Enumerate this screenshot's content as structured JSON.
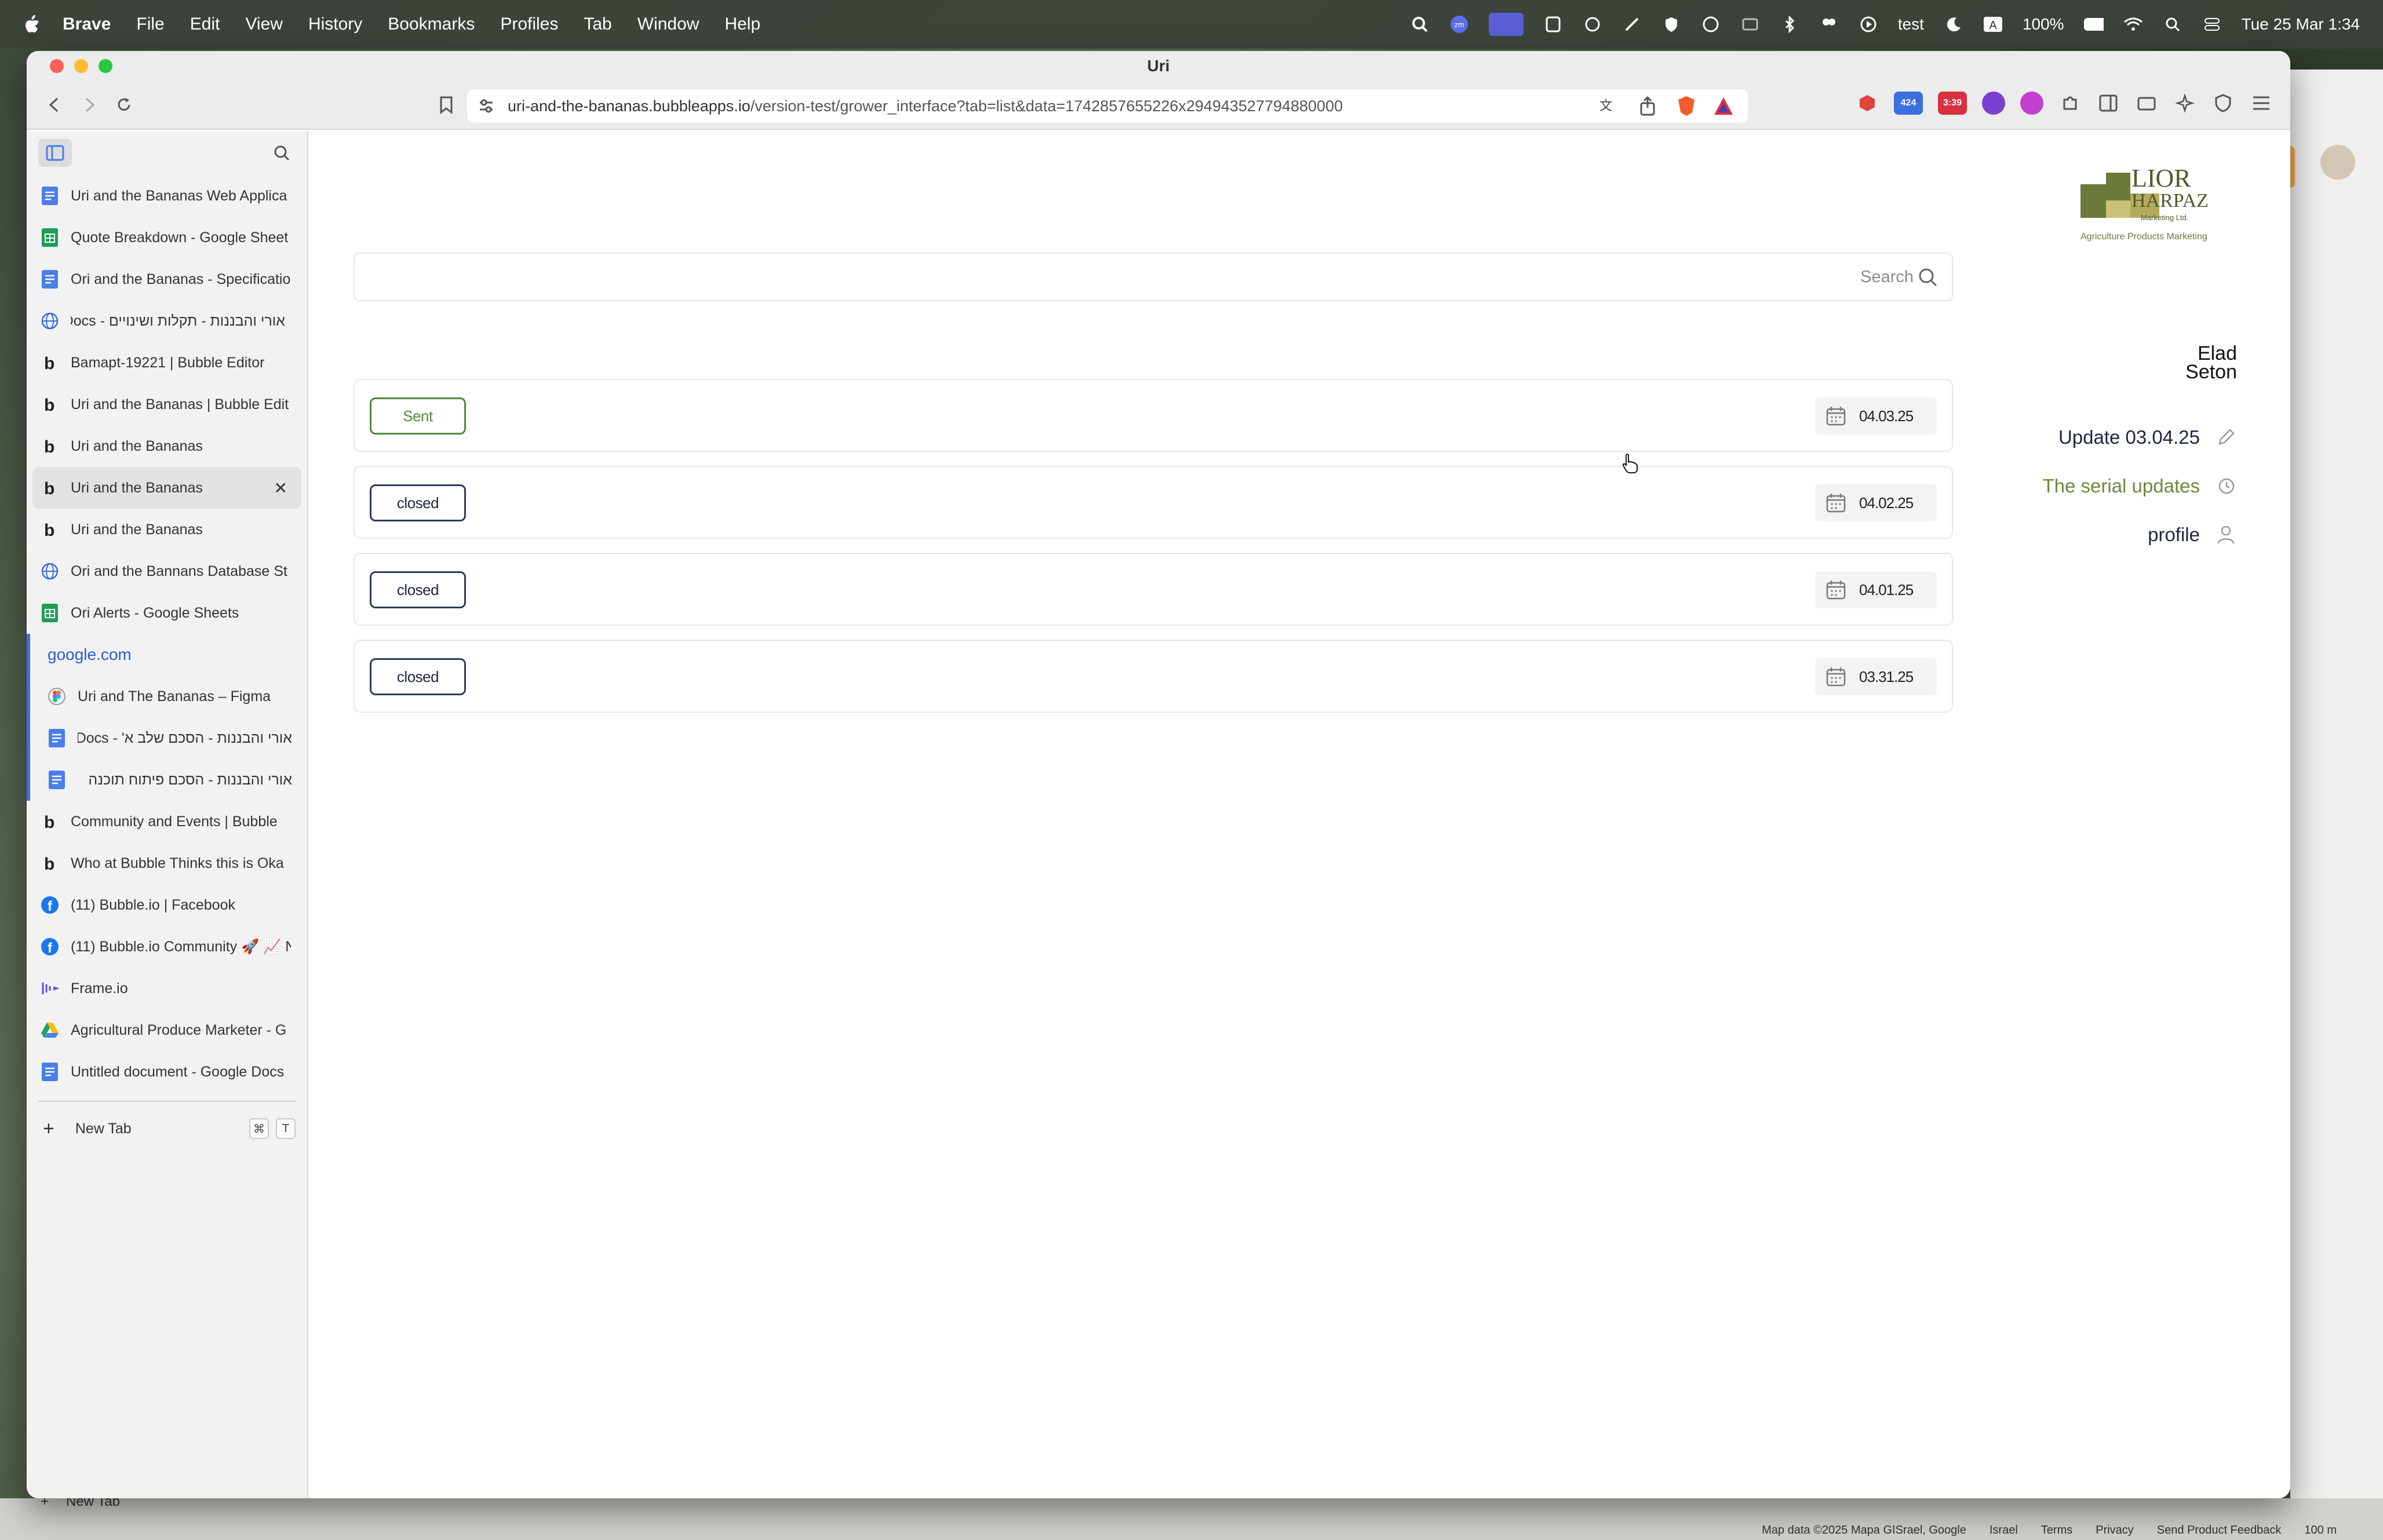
{
  "menubar": {
    "app": "Brave",
    "items": [
      "File",
      "Edit",
      "View",
      "History",
      "Bookmarks",
      "Profiles",
      "Tab",
      "Window",
      "Help"
    ],
    "tray": {
      "badge_text": "test",
      "battery": "100%",
      "datetime": "Tue 25 Mar  1:34"
    }
  },
  "window": {
    "title": "Uri",
    "url_host": "uri-and-the-bananas.bubbleapps.io",
    "url_path": "/version-test/grower_interface?tab=list&data=1742857655226x294943527794880000",
    "ext_badges": {
      "a": "424",
      "b": "3:39"
    }
  },
  "sidebar": {
    "tabs": [
      {
        "label": "Uri and the Bananas Web Applica",
        "icon": "google-docs-icon"
      },
      {
        "label": "Quote Breakdown - Google Sheet",
        "icon": "google-sheets-icon"
      },
      {
        "label": "Ori and the Bananas - Specificatio",
        "icon": "google-docs-icon"
      },
      {
        "label": "אורי והבננות - תקלות ושינויים - Docs",
        "icon": "globe-icon"
      },
      {
        "label": "Bamapt-19221 | Bubble Editor",
        "icon": "bubble-icon"
      },
      {
        "label": "Uri and the Bananas | Bubble Edit",
        "icon": "bubble-icon"
      },
      {
        "label": "Uri and the Bananas",
        "icon": "bubble-icon"
      },
      {
        "label": "Uri and the Bananas",
        "icon": "bubble-icon",
        "active": true
      },
      {
        "label": "Uri and the Bananas",
        "icon": "bubble-icon"
      },
      {
        "label": "Ori and the Bannans Database St",
        "icon": "globe-icon"
      },
      {
        "label": "Ori Alerts - Google Sheets",
        "icon": "google-sheets-icon"
      }
    ],
    "group_label": "google.com",
    "group_tabs": [
      {
        "label": "Uri and The Bananas – Figma",
        "icon": "figma-icon"
      },
      {
        "label": "אורי והבננות - הסכם שלב א' - Docs",
        "icon": "google-docs-icon"
      },
      {
        "label": "אורי והבננות - הסכם פיתוח תוכנה",
        "icon": "google-docs-icon"
      }
    ],
    "more_tabs": [
      {
        "label": "Community and Events | Bubble",
        "icon": "bubble-icon"
      },
      {
        "label": "Who at Bubble Thinks this is Oka",
        "icon": "bubble-icon"
      },
      {
        "label": "(11) Bubble.io | Facebook",
        "icon": "facebook-icon"
      },
      {
        "label": "(11) Bubble.io Community 🚀 📈 N",
        "icon": "facebook-icon"
      },
      {
        "label": "Frame.io",
        "icon": "frame-io-icon"
      },
      {
        "label": "Agricultural Produce Marketer - G",
        "icon": "google-drive-icon"
      },
      {
        "label": "Untitled document - Google Docs",
        "icon": "google-docs-icon"
      }
    ],
    "new_tab": {
      "label": "New Tab",
      "k1": "⌘",
      "k2": "T"
    }
  },
  "main": {
    "search_placeholder": "Search",
    "rows": [
      {
        "status": "Sent",
        "date": "04.03.25"
      },
      {
        "status": "closed",
        "date": "04.02.25"
      },
      {
        "status": "closed",
        "date": "04.01.25"
      },
      {
        "status": "closed",
        "date": "03.31.25"
      }
    ],
    "logo": {
      "line1": "LIOR",
      "line2": "HARPAZ",
      "line3": "Marketing Ltd.",
      "tagline": "Agriculture Products Marketing"
    },
    "user": {
      "first": "Elad",
      "last": "Seton"
    },
    "menu": {
      "update": "Update 03.04.25",
      "serial": "The serial updates",
      "profile": "profile"
    }
  },
  "background": {
    "new_tab": "New Tab",
    "map_footer": [
      "Map data ©2025 Mapa GISrael, Google",
      "Israel",
      "Terms",
      "Privacy",
      "Send Product Feedback",
      "100 m"
    ]
  },
  "colors": {
    "accent_green": "#4f8a3b",
    "link_green": "#6a8a3a",
    "navy": "#1e2640",
    "group_blue": "#3b6fe0"
  }
}
